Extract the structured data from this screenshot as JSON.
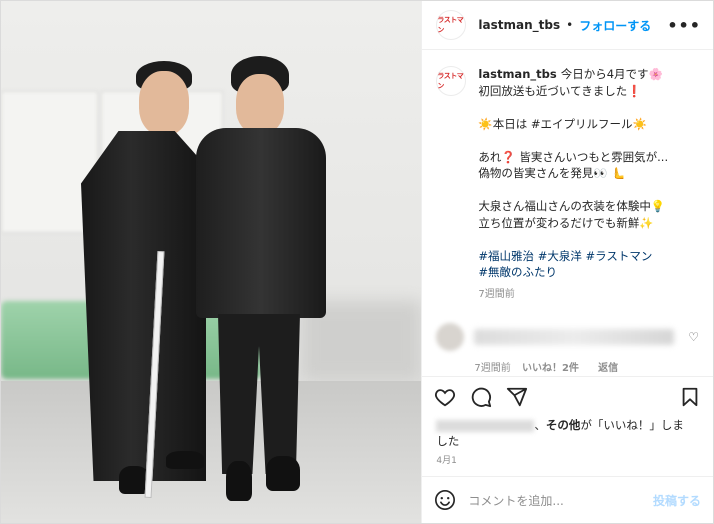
{
  "post": {
    "username": "lastman_tbs",
    "follow_label": "フォローする",
    "avatar_text": "ラストマン",
    "caption_lines": [
      "今日から4月です🌸",
      "初回放送も近づいてきました❗",
      "",
      "☀️本日は #エイプリルフール☀️",
      "",
      "あれ❓ 皆実さんいつもと雰囲気が...",
      "偽物の皆実さんを発見👀 🫷",
      "",
      "大泉さん福山さんの衣装を体験中💡",
      "立ち位置が変わるだけでも新鮮✨",
      "",
      "#福山雅治 #大泉洋 #ラストマン",
      "#無敵のふたり"
    ],
    "caption_time": "7週間前",
    "comment_time": "7週間前",
    "comment_likes": "いいね！2件",
    "reply_label": "返信",
    "likes_suffix_bold": "その他",
    "likes_text": "、その他が「いいね！」しました",
    "likes_mid": "が",
    "likes_quote": "「いいね！」しま",
    "likes_end": "した",
    "date": "4月1",
    "add_comment_placeholder": "コメントを追加...",
    "post_button": "投稿する"
  },
  "icons": {
    "more": "more-horizontal-icon",
    "like": "heart-icon",
    "comment": "comment-icon",
    "share": "share-icon",
    "save": "bookmark-icon",
    "emoji": "emoji-icon"
  },
  "colors": {
    "link": "#0095f6",
    "hashtag": "#00376b",
    "muted": "#8e8e8e"
  }
}
